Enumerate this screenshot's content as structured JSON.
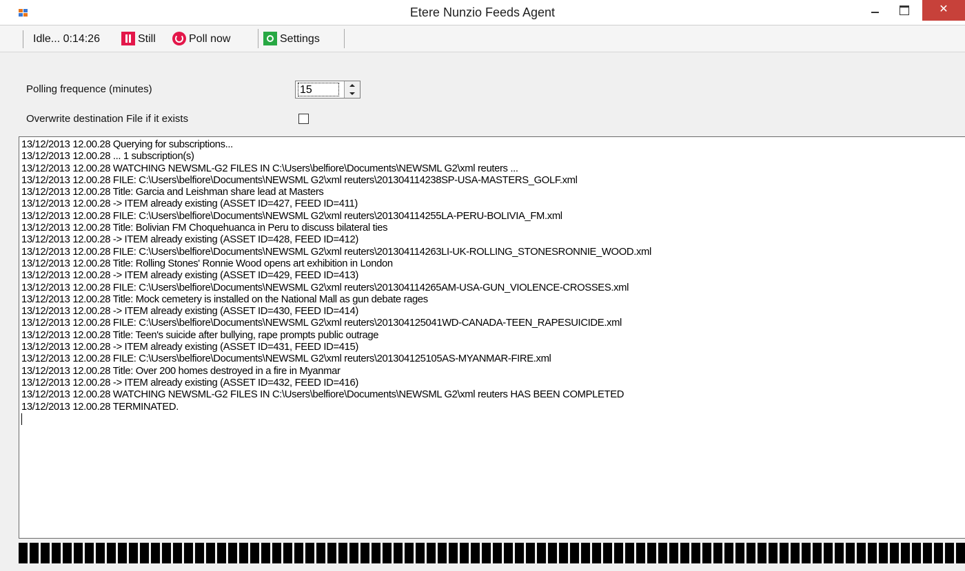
{
  "window": {
    "title": "Etere Nunzio Feeds Agent",
    "close_glyph": "✕"
  },
  "toolbar": {
    "status": "Idle... 0:14:26",
    "still_label": "Still",
    "poll_label": "Poll now",
    "settings_label": "Settings",
    "icons": [
      "pause-icon",
      "poll-icon",
      "gear-icon"
    ]
  },
  "settings": {
    "polling_label": "Polling frequence (minutes)",
    "polling_value": "15",
    "overwrite_label": "Overwrite destination File if it exists",
    "overwrite_checked": false
  },
  "log": {
    "lines": [
      "13/12/2013 12.00.28  Querying for subscriptions...",
      "13/12/2013 12.00.28  ... 1 subscription(s)",
      "13/12/2013 12.00.28  WATCHING NEWSML-G2 FILES IN C:\\Users\\belfiore\\Documents\\NEWSML G2\\xml reuters ...",
      "13/12/2013 12.00.28  FILE: C:\\Users\\belfiore\\Documents\\NEWSML G2\\xml reuters\\201304114238SP-USA-MASTERS_GOLF.xml",
      "13/12/2013 12.00.28  Title: Garcia and Leishman share lead at Masters",
      "13/12/2013 12.00.28  -> ITEM already existing (ASSET ID=427, FEED ID=411)",
      "13/12/2013 12.00.28  FILE: C:\\Users\\belfiore\\Documents\\NEWSML G2\\xml reuters\\201304114255LA-PERU-BOLIVIA_FM.xml",
      "13/12/2013 12.00.28  Title: Bolivian FM Choquehuanca in Peru to discuss bilateral ties",
      "13/12/2013 12.00.28  -> ITEM already existing (ASSET ID=428, FEED ID=412)",
      "13/12/2013 12.00.28  FILE: C:\\Users\\belfiore\\Documents\\NEWSML G2\\xml reuters\\201304114263LI-UK-ROLLING_STONESRONNIE_WOOD.xml",
      "13/12/2013 12.00.28  Title: Rolling Stones' Ronnie Wood opens art exhibition in London",
      "13/12/2013 12.00.28  -> ITEM already existing (ASSET ID=429, FEED ID=413)",
      "13/12/2013 12.00.28  FILE: C:\\Users\\belfiore\\Documents\\NEWSML G2\\xml reuters\\201304114265AM-USA-GUN_VIOLENCE-CROSSES.xml",
      "13/12/2013 12.00.28  Title: Mock cemetery is installed on the National Mall as gun debate rages",
      "13/12/2013 12.00.28  -> ITEM already existing (ASSET ID=430, FEED ID=414)",
      "13/12/2013 12.00.28  FILE: C:\\Users\\belfiore\\Documents\\NEWSML G2\\xml reuters\\201304125041WD-CANADA-TEEN_RAPESUICIDE.xml",
      "13/12/2013 12.00.28  Title: Teen's suicide after bullying, rape prompts public outrage",
      "13/12/2013 12.00.28  -> ITEM already existing (ASSET ID=431, FEED ID=415)",
      "13/12/2013 12.00.28  FILE: C:\\Users\\belfiore\\Documents\\NEWSML G2\\xml reuters\\201304125105AS-MYANMAR-FIRE.xml",
      "13/12/2013 12.00.28  Title: Over 200 homes destroyed in a fire in Myanmar",
      "13/12/2013 12.00.28  -> ITEM already existing (ASSET ID=432, FEED ID=416)",
      "13/12/2013 12.00.28  WATCHING NEWSML-G2 FILES IN C:\\Users\\belfiore\\Documents\\NEWSML G2\\xml reuters HAS BEEN COMPLETED",
      "13/12/2013 12.00.28  TERMINATED."
    ]
  },
  "progress": {
    "style": "marquee",
    "fill_fraction": 1.0
  }
}
